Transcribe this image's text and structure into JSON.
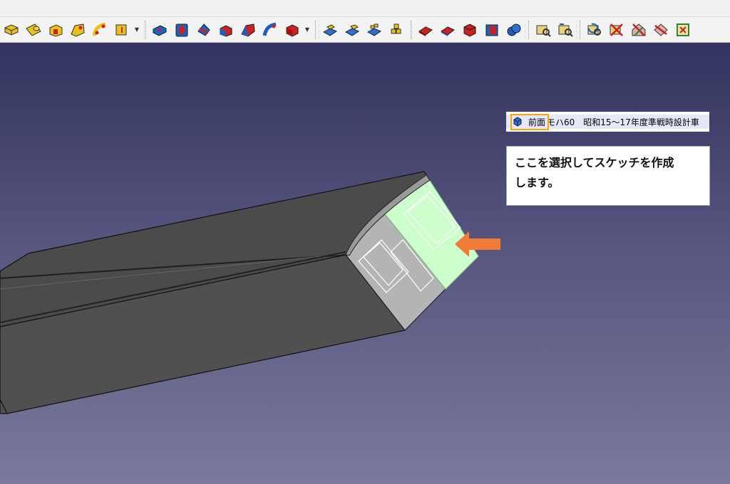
{
  "toolbar": {
    "groups": [
      [
        "box-icon",
        "cylinder-icon",
        "sphere-icon",
        "cone-icon",
        "torus-icon",
        "primitives-icon"
      ],
      [
        "extrude-icon",
        "revolve-icon",
        "mirror-icon",
        "fillet-icon",
        "chamfer-icon",
        "make-face-icon",
        "ruled-surface-icon"
      ],
      [
        "loft-icon",
        "sweep-icon",
        "section-icon",
        "cross-sections-icon"
      ],
      [
        "compound-tools-icon",
        "check-geometry-icon",
        "boolean-icon",
        "cut-icon",
        "union-icon",
        "intersect-icon"
      ],
      [
        "measure-linear-icon",
        "measure-angular-icon",
        "measure-refresh-icon",
        "measure-clear-icon",
        "measure-toggle-all-icon",
        "measure-toggle-3d-icon",
        "measure-toggle-delta-icon"
      ]
    ]
  },
  "tree": {
    "item_label": "前面",
    "item_suffix": "モハ60　昭和15～17年度準戦時設計車",
    "icon": "part-body-icon"
  },
  "callout": {
    "line1": "ここを選択してスケッチを作成",
    "line2": "します。"
  },
  "colors": {
    "highlight_border": "#f5a800",
    "arrow": "#f07c38",
    "selected_face": "#ccffcc",
    "body_dark": "#4a4a4a",
    "face_grey": "#b4b4b4"
  }
}
